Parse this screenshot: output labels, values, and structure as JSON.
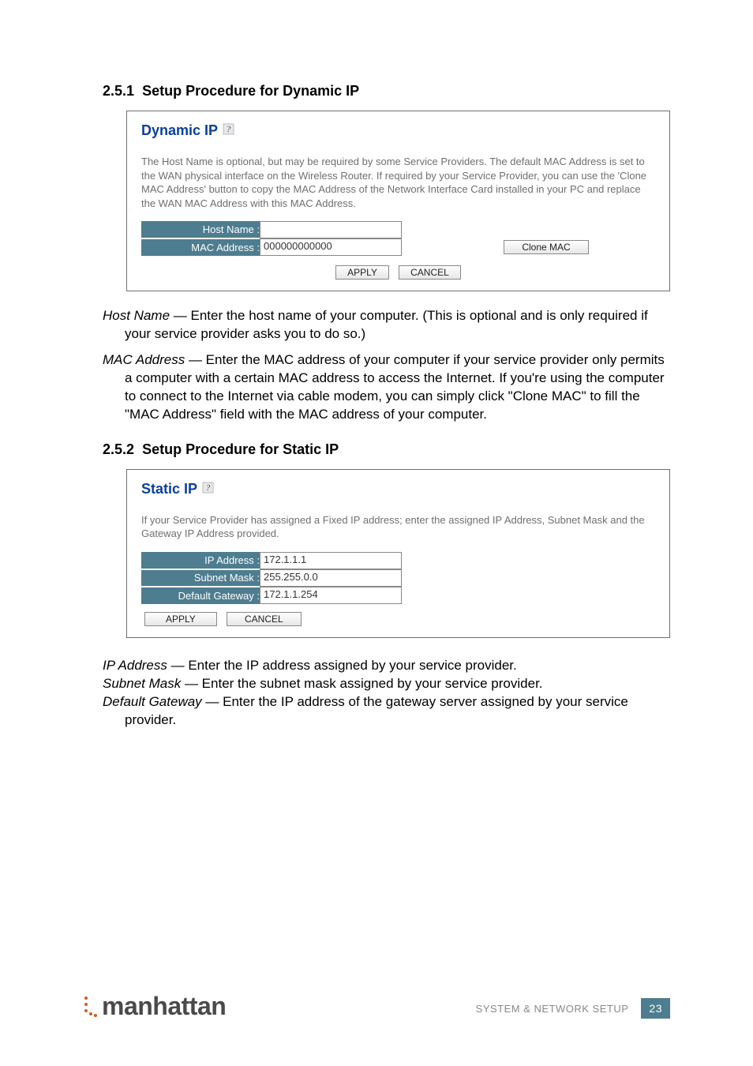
{
  "sections": {
    "dynamic": {
      "number": "2.5.1",
      "title": "Setup Procedure for Dynamic IP",
      "panel_title": "Dynamic IP",
      "desc": "The Host Name is optional, but may be required by some Service Providers. The default MAC Address is set to the WAN physical interface on the Wireless Router. If required by your Service Provider, you can use the 'Clone MAC Address' button to copy the MAC Address of the Network Interface Card installed in your PC and replace the WAN MAC Address with this MAC Address.",
      "fields": {
        "host_name_label": "Host Name :",
        "host_name_value": "",
        "mac_label": "MAC Address :",
        "mac_value": "000000000000"
      },
      "buttons": {
        "clone": "Clone MAC",
        "apply": "APPLY",
        "cancel": "CANCEL"
      },
      "explain": [
        {
          "term": "Host Name",
          "text": " — Enter the host name of your computer. (This is optional and is only required if your service provider asks you to do so.)"
        },
        {
          "term": "MAC Address",
          "text": " — Enter the MAC address of your computer if your service provider only permits a computer with a certain MAC address to access the Internet. If you're using the computer to connect to the Internet via cable modem, you can simply click \"Clone MAC\" to fill the \"MAC Address\" field with the MAC address of your computer."
        }
      ]
    },
    "static": {
      "number": "2.5.2",
      "title": "Setup Procedure for Static IP",
      "panel_title": "Static IP",
      "desc": "If your Service Provider has assigned a Fixed IP address; enter the assigned IP Address, Subnet Mask and the Gateway IP Address provided.",
      "fields": {
        "ip_label": "IP Address :",
        "ip_value": "172.1.1.1",
        "mask_label": "Subnet Mask :",
        "mask_value": "255.255.0.0",
        "gw_label": "Default Gateway :",
        "gw_value": "172.1.1.254"
      },
      "buttons": {
        "apply": "APPLY",
        "cancel": "CANCEL"
      },
      "explain": [
        {
          "term": "IP Address",
          "text": " — Enter the IP address assigned by your service provider."
        },
        {
          "term": "Subnet Mask",
          "text": " — Enter the subnet mask assigned by your service provider."
        },
        {
          "term": "Default Gateway",
          "text": " — Enter the IP address of the gateway server assigned by your service provider."
        }
      ]
    }
  },
  "footer": {
    "brand": "manhattan",
    "section_label": "SYSTEM & NETWORK SETUP",
    "page": "23"
  }
}
